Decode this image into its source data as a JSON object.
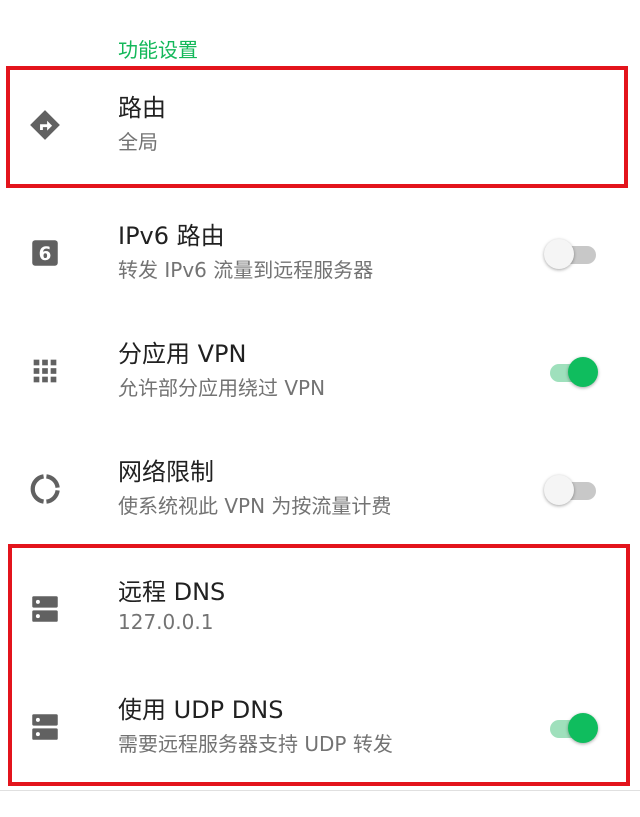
{
  "section": {
    "title": "功能设置"
  },
  "items": [
    {
      "title": "路由",
      "summary": "全局",
      "icon": "route-icon"
    },
    {
      "title": "IPv6 路由",
      "summary": "转发 IPv6 流量到远程服务器",
      "icon": "ipv6-icon",
      "toggle": false
    },
    {
      "title": "分应用 VPN",
      "summary": "允许部分应用绕过 VPN",
      "icon": "apps-grid-icon",
      "toggle": true
    },
    {
      "title": "网络限制",
      "summary": "使系统视此 VPN 为按流量计费",
      "icon": "data-usage-icon",
      "toggle": false
    },
    {
      "title": "远程 DNS",
      "summary": "127.0.0.1",
      "icon": "dns-server-icon"
    },
    {
      "title": "使用 UDP DNS",
      "summary": "需要远程服务器支持 UDP 转发",
      "icon": "dns-server-icon",
      "toggle": true
    }
  ],
  "colors": {
    "accent": "#14b85a",
    "switch_on": "#0fbd5e",
    "highlight": "#e3141c",
    "icon": "#616161"
  }
}
